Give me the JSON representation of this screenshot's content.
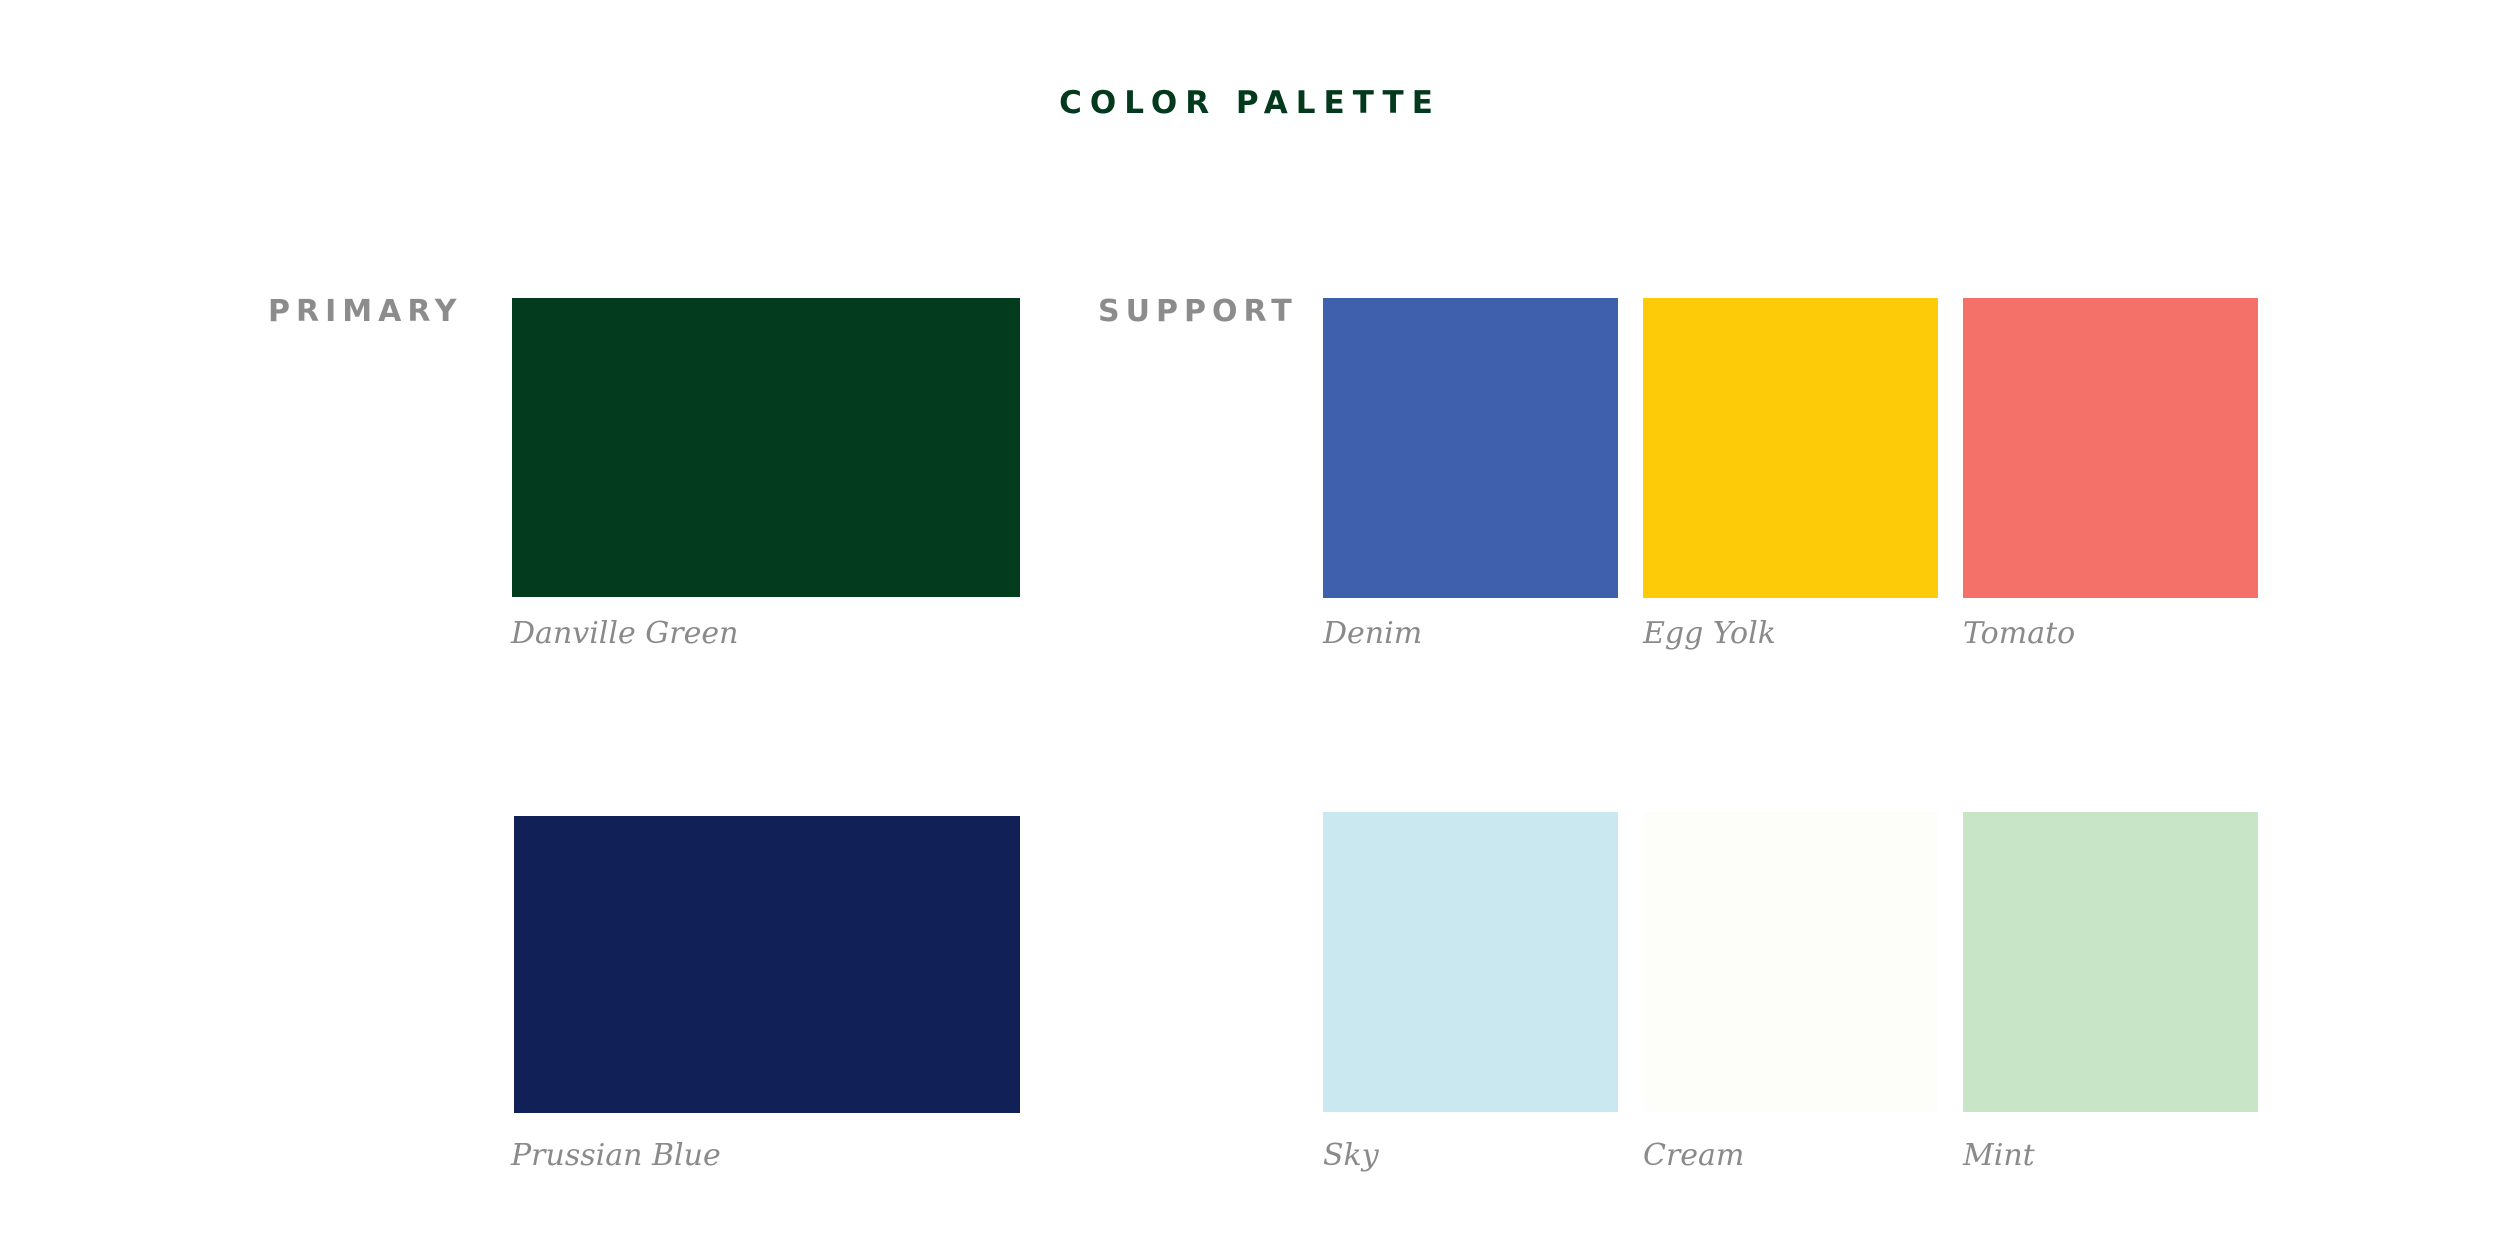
{
  "title": "COLOR PALETTE",
  "primary": {
    "label": "PRIMARY",
    "swatches": [
      {
        "name": "Danville Green",
        "color": "#023b1e"
      },
      {
        "name": "Prussian Blue",
        "color": "#112157"
      }
    ]
  },
  "support": {
    "label": "SUPPORT",
    "swatches": [
      {
        "name": "Denim",
        "color": "#3f60ad"
      },
      {
        "name": "Egg Yolk",
        "color": "#fdcb07"
      },
      {
        "name": "Tomato",
        "color": "#f37168"
      },
      {
        "name": "Sky",
        "color": "#cae8f0"
      },
      {
        "name": "Cream",
        "color": "#fdfdf9"
      },
      {
        "name": "Mint",
        "color": "#c8e6c7"
      }
    ]
  }
}
